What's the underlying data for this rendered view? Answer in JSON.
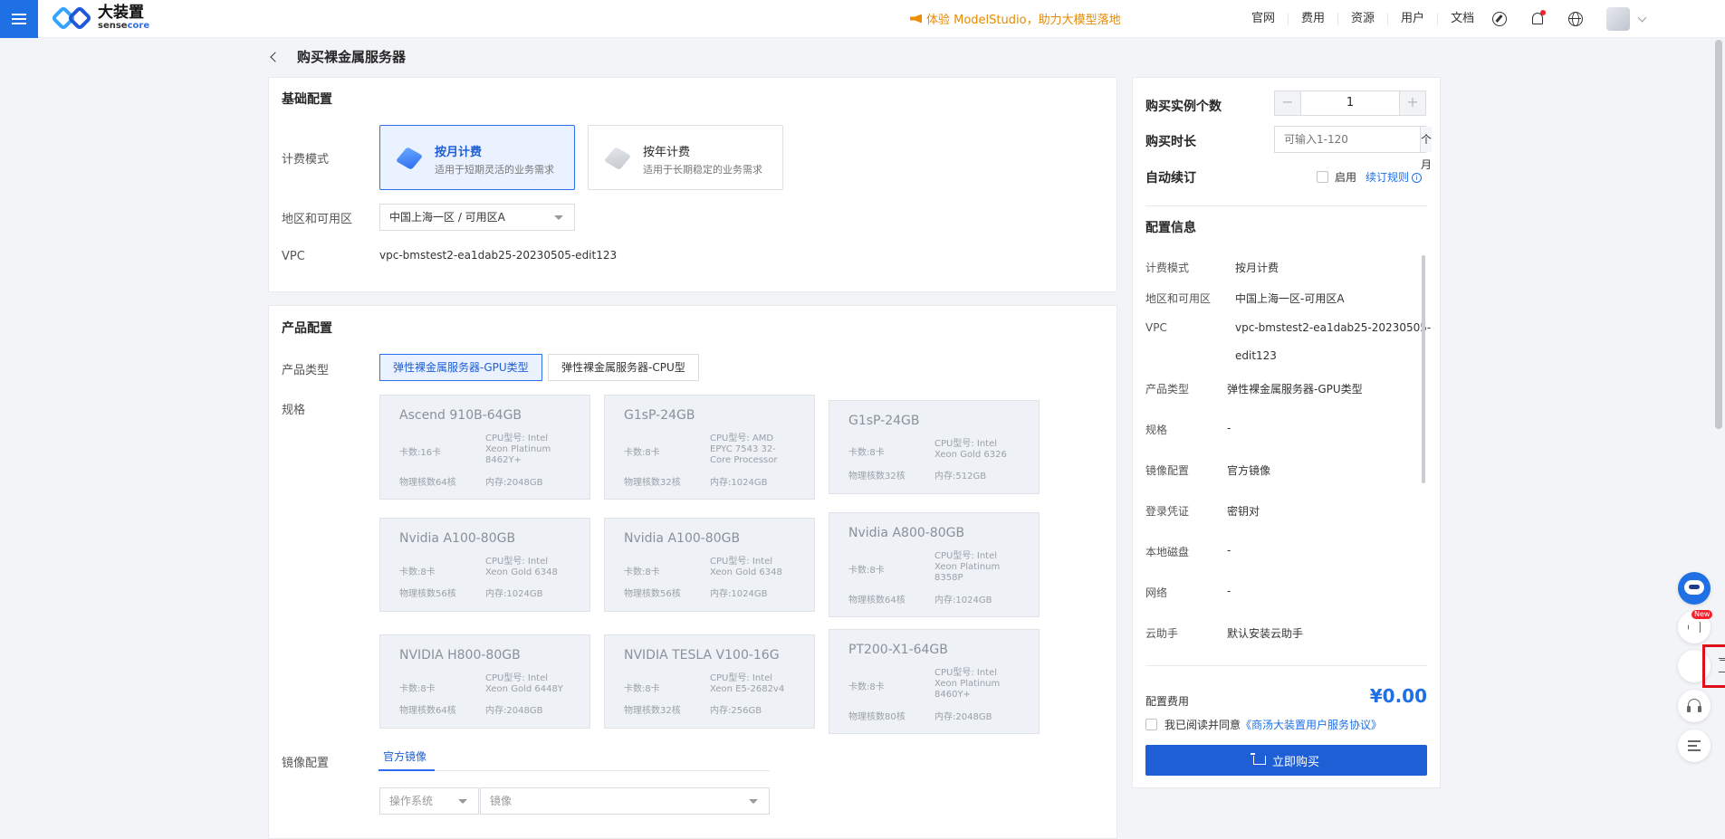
{
  "topbar": {
    "logo_cn": "大装置",
    "logo_en_a": "sense",
    "logo_en_b": "core",
    "promo": "体验 ModelStudio，助力大模型落地",
    "nav": [
      "官网",
      "费用",
      "资源",
      "用户",
      "文档"
    ],
    "icons": [
      "menu-icon",
      "compass-icon",
      "bell-icon",
      "globe-icon",
      "chevron-down-icon"
    ]
  },
  "page": {
    "title": "购买裸金属服务器"
  },
  "basic": {
    "title": "基础配置",
    "billing_label": "计费模式",
    "billing_options": [
      {
        "title": "按月计费",
        "desc": "适用于短期灵活的业务需求",
        "selected": true
      },
      {
        "title": "按年计费",
        "desc": "适用于长期稳定的业务需求",
        "selected": false
      }
    ],
    "region_label": "地区和可用区",
    "region_value": "中国上海一区 / 可用区A",
    "vpc_label": "VPC",
    "vpc_value": "vpc-bmstest2-ea1dab25-20230505-edit123"
  },
  "product": {
    "title": "产品配置",
    "type_label": "产品类型",
    "types": [
      "弹性裸金属服务器-GPU类型",
      "弹性裸金属服务器-CPU型"
    ],
    "spec_label": "规格",
    "specs": [
      {
        "name": "Ascend 910B-64GB",
        "cards": "卡数:16卡",
        "cpu": "CPU型号: Intel Xeon Platinum 8462Y+",
        "cores": "物理核数64核",
        "mem": "内存:2048GB"
      },
      {
        "name": "G1sP-24GB",
        "cards": "卡数:8卡",
        "cpu": "CPU型号: AMD EPYC 7543 32-Core Processor",
        "cores": "物理核数32核",
        "mem": "内存:1024GB"
      },
      {
        "name": "G1sP-24GB",
        "cards": "卡数:8卡",
        "cpu": "CPU型号: Intel Xeon Gold 6326",
        "cores": "物理核数32核",
        "mem": "内存:512GB"
      },
      {
        "name": "Nvidia A100-80GB",
        "cards": "卡数:8卡",
        "cpu": "CPU型号: Intel Xeon Gold 6348",
        "cores": "物理核数56核",
        "mem": "内存:1024GB"
      },
      {
        "name": "Nvidia A100-80GB",
        "cards": "卡数:8卡",
        "cpu": "CPU型号: Intel Xeon Gold 6348",
        "cores": "物理核数56核",
        "mem": "内存:1024GB"
      },
      {
        "name": "Nvidia A800-80GB",
        "cards": "卡数:8卡",
        "cpu": "CPU型号: Intel Xeon Platinum 8358P",
        "cores": "物理核数64核",
        "mem": "内存:1024GB"
      },
      {
        "name": "NVIDIA H800-80GB",
        "cards": "卡数:8卡",
        "cpu": "CPU型号: Intel Xeon Gold 6448Y",
        "cores": "物理核数64核",
        "mem": "内存:2048GB"
      },
      {
        "name": "NVIDIA TESLA V100-16G",
        "cards": "卡数:8卡",
        "cpu": "CPU型号: Intel Xeon E5-2682v4",
        "cores": "物理核数32核",
        "mem": "内存:256GB"
      },
      {
        "name": "PT200-X1-64GB",
        "cards": "卡数:8卡",
        "cpu": "CPU型号: Intel Xeon Platinum 8460Y+",
        "cores": "物理核数80核",
        "mem": "内存:2048GB"
      }
    ],
    "image_label": "镜像配置",
    "image_tab": "官方镜像",
    "os_placeholder": "操作系统",
    "image_placeholder": "镜像"
  },
  "order": {
    "qty_label": "购买实例个数",
    "qty_minus": "−",
    "qty_value": "1",
    "qty_plus": "+",
    "duration_label": "购买时长",
    "duration_placeholder": "可输入1-120",
    "duration_unit": "个月",
    "renew_label": "自动续订",
    "renew_enable": "启用",
    "renew_rules": "续订规则",
    "config_title": "配置信息",
    "config": [
      {
        "label": "计费模式",
        "value": "按月计费"
      },
      {
        "label": "地区和可用区",
        "value": "中国上海一区-可用区A"
      },
      {
        "label": "VPC",
        "value": "vpc-bmstest2-ea1dab25-20230505-",
        "value2": "edit123"
      },
      {
        "label": "产品类型",
        "value": "弹性裸金属服务器-GPU类型"
      },
      {
        "label": "规格",
        "value": "-"
      },
      {
        "label": "镜像配置",
        "value": "官方镜像"
      },
      {
        "label": "登录凭证",
        "value": "密钥对"
      },
      {
        "label": "本地磁盘",
        "value": "-"
      },
      {
        "label": "网络",
        "value": "-"
      },
      {
        "label": "云助手",
        "value": "默认安装云助手"
      }
    ],
    "fee_label": "配置费用",
    "fee_value": "¥0.00",
    "agree_prefix": "我已阅读并同意",
    "agree_link": "《商汤大装置用户服务协议》",
    "buy_label": "立即购买"
  },
  "float_tools": {
    "new_badge": "New"
  }
}
